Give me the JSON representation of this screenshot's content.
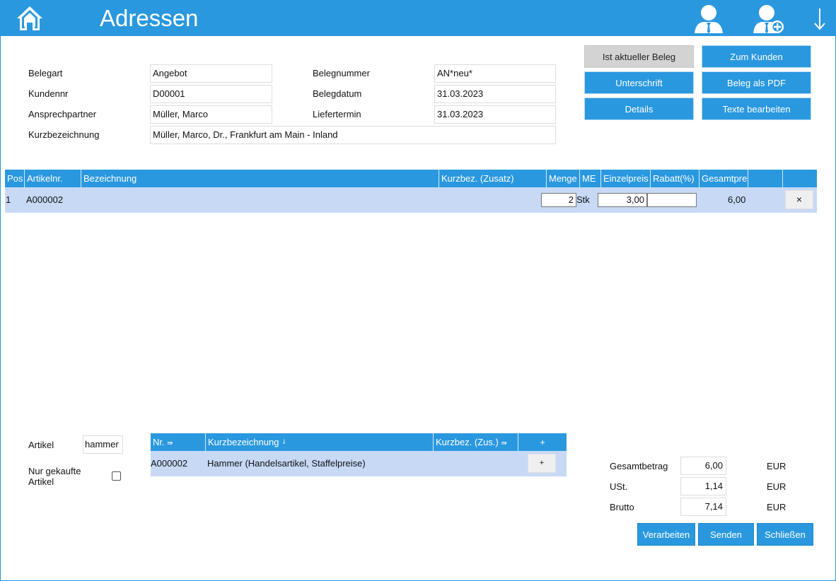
{
  "header": {
    "title": "Adressen"
  },
  "buttons": {
    "current_doc": "Ist aktueller Beleg",
    "to_customer": "Zum Kunden",
    "signature": "Unterschrift",
    "doc_pdf": "Beleg als PDF",
    "details": "Details",
    "edit_texts": "Texte bearbeiten",
    "process": "Verarbeiten",
    "send": "Senden",
    "close": "Schließen"
  },
  "form": {
    "doctype_label": "Belegart",
    "doctype_value": "Angebot",
    "custno_label": "Kundennr",
    "custno_value": "D00001",
    "contact_label": "Ansprechpartner",
    "contact_value": "Müller, Marco",
    "short_label": "Kurzbezeichnung",
    "short_value": "Müller, Marco, Dr., Frankfurt am Main - Inland",
    "docno_label": "Belegnummer",
    "docno_value": "AN*neu*",
    "docdate_label": "Belegdatum",
    "docdate_value": "31.03.2023",
    "delivery_label": "Liefertermin",
    "delivery_value": "31.03.2023"
  },
  "positions": {
    "columns": [
      "Pos",
      "Artikelnr.",
      "Bezeichnung",
      "Kurzbez. (Zusatz)",
      "Menge",
      "ME",
      "Einzelpreis",
      "Rabatt(%)",
      "Gesamtpre"
    ],
    "rows": [
      {
        "pos": "1",
        "artnr": "A000002",
        "bezeichnung": "",
        "kurzbez": "",
        "menge": "2",
        "me": "Stk",
        "einzelpreis": "3,00",
        "rabatt": "",
        "gesamt": "6,00",
        "delete": "×"
      }
    ]
  },
  "search": {
    "article_label": "Artikel",
    "article_value": "hammer",
    "bought_only_label": "Nur gekaufte Artikel",
    "bought_only_checked": false
  },
  "results": {
    "columns": [
      "Nr.",
      "Kurzbezeichnung",
      "Kurzbez. (Zus.)",
      "+"
    ],
    "rows": [
      {
        "nr": "A000002",
        "kurzbez": "Hammer (Handelsartikel, Staffelpreise)",
        "zusatz": "",
        "add": "+"
      }
    ]
  },
  "totals": {
    "net_label": "Gesamtbetrag",
    "net_value": "6,00",
    "vat_label": "USt.",
    "vat_value": "1,14",
    "gross_label": "Brutto",
    "gross_value": "7,14",
    "currency": "EUR"
  },
  "colors": {
    "accent": "#2a98df",
    "row_highlight": "#c7d9f5"
  }
}
